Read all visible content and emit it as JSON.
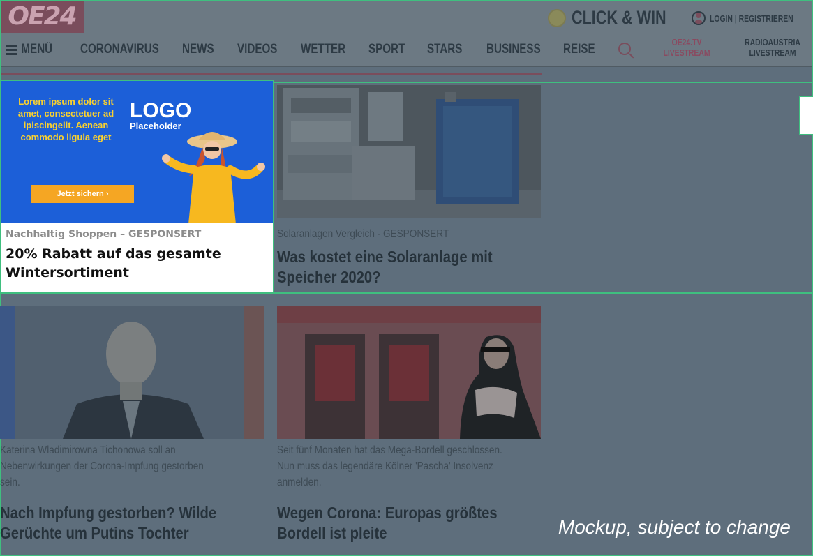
{
  "header": {
    "logo": "OE24",
    "click_win": "CLICK & WIN",
    "login": "LOGIN",
    "separator": "|",
    "register": "REGISTRIEREN"
  },
  "nav": {
    "menu": "MENÜ",
    "items": [
      "CORONAVIRUS",
      "NEWS",
      "VIDEOS",
      "WETTER",
      "SPORT",
      "STARS",
      "BUSINESS",
      "REISE"
    ],
    "live1_line1": "OE24.TV",
    "live1_line2": "LIVESTREAM",
    "live2_line1": "RADIOAUSTRIA",
    "live2_line2": "LIVESTREAM"
  },
  "ad": {
    "copy": "Lorem ipsum dolor sit amet, consectetuer ad ipiscingelit. Aenean commodo ligula eget",
    "logo": "LOGO",
    "logo_sub": "Placeholder",
    "cta": "Jetzt sichern ›",
    "kicker": "Nachhaltig Shoppen – GESPONSERT",
    "title_line1": "20% Rabatt auf das gesamte",
    "title_line2": "Wintersortiment"
  },
  "tiles": {
    "solar": {
      "kicker": "Solaranlagen Vergleich  - GESPONSERT",
      "title_line1": "Was kostet eine Solaranlage mit",
      "title_line2": "Speicher 2020?"
    },
    "putin": {
      "kicker_line1": "Katerina Wladimirowna Tichonowa soll an",
      "kicker_line2": "Nebenwirkungen der Corona-Impfung gestorben",
      "kicker_line3": "sein.",
      "title_line1": "Nach Impfung gestorben? Wilde",
      "title_line2": "Gerüchte um Putins Tochter"
    },
    "bordell": {
      "kicker_line1": "Seit fünf Monaten hat das Mega-Bordell geschlossen.",
      "kicker_line2": "Nun muss das legendäre Kölner 'Pascha' Insolvenz",
      "kicker_line3": "anmelden.",
      "title_line1": "Wegen Corona: Europas größtes",
      "title_line2": "Bordell ist pleite"
    }
  },
  "watermark": "Mockup, subject to change",
  "colors": {
    "overlay": "#5e6e7c",
    "accent": "#7a4d5c",
    "outline": "#3fbf7f",
    "ad_blue": "#1c5fd8",
    "ad_yellow": "#fbd22e",
    "cta_orange": "#f5a623"
  }
}
